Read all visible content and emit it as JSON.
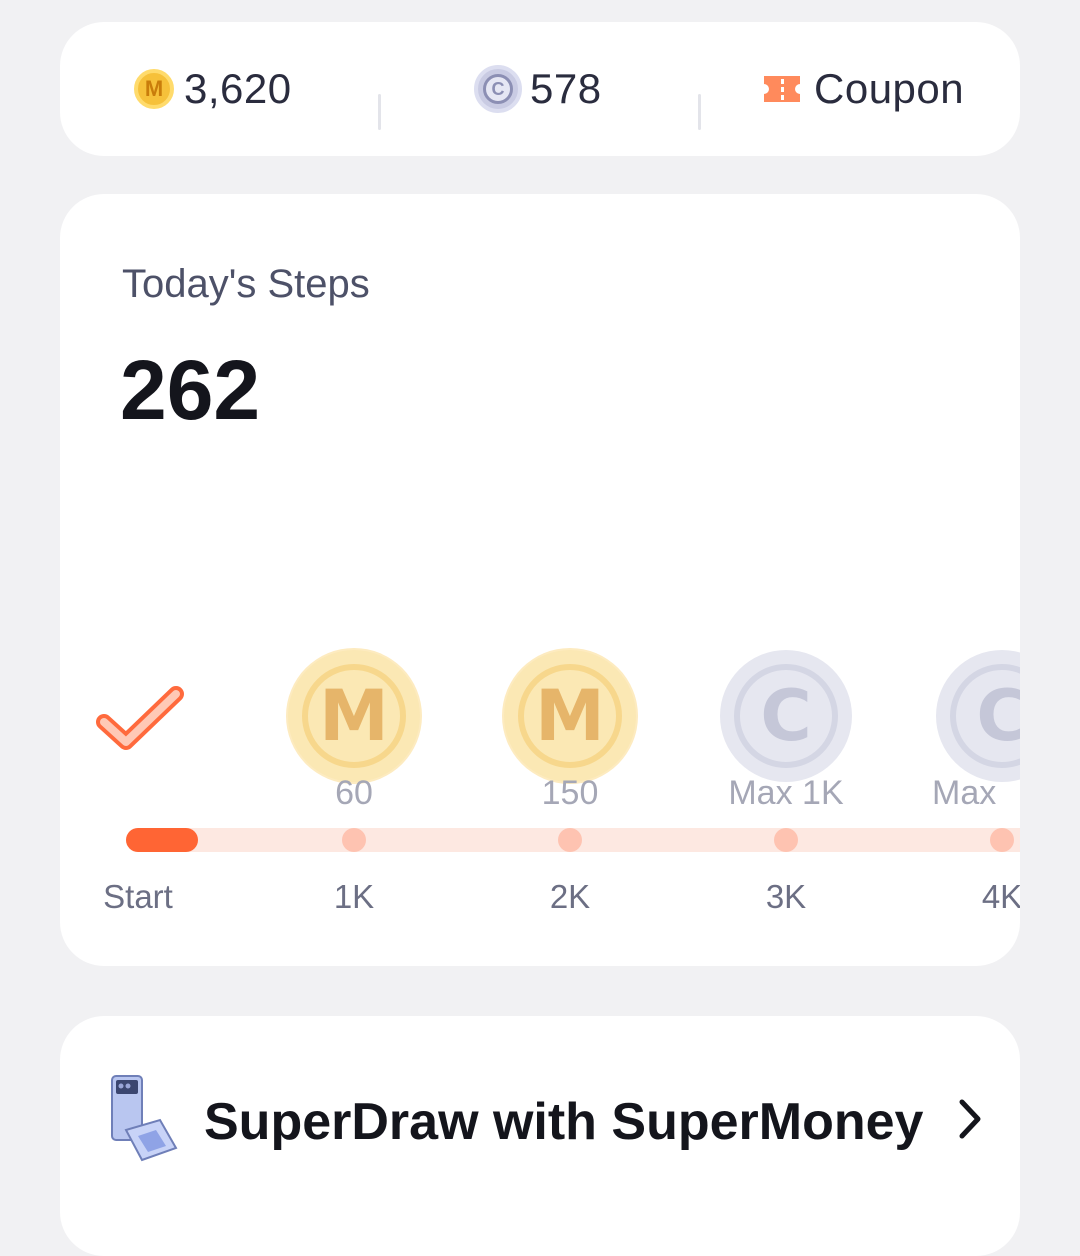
{
  "balance": {
    "supermoney": "3,620",
    "supermoney_icon": "m-coin-icon",
    "supercoins": "578",
    "supercoins_icon": "c-coin-icon",
    "coupon_label": "Coupon",
    "coupon_icon": "ticket-icon"
  },
  "steps": {
    "label": "Today's Steps",
    "value": "262",
    "check_icon": "check-icon",
    "progress_fraction": 0.07,
    "rewards": [
      {
        "type": "M",
        "glyph": "M",
        "label": "60"
      },
      {
        "type": "M",
        "glyph": "M",
        "label": "150"
      },
      {
        "type": "C",
        "glyph": "C",
        "label": "Max 1K"
      },
      {
        "type": "C",
        "glyph": "C",
        "label": "Max"
      }
    ],
    "ticks": [
      "Start",
      "1K",
      "2K",
      "3K",
      "4K"
    ]
  },
  "superdraw": {
    "title": "SuperDraw with SuperMoney",
    "icon": "phone-icon",
    "chevron": "chevron-right-icon"
  },
  "colors": {
    "accent": "#ff6534",
    "track": "#fde8e1",
    "dot": "#fec3b1",
    "background": "#f1f1f3"
  }
}
